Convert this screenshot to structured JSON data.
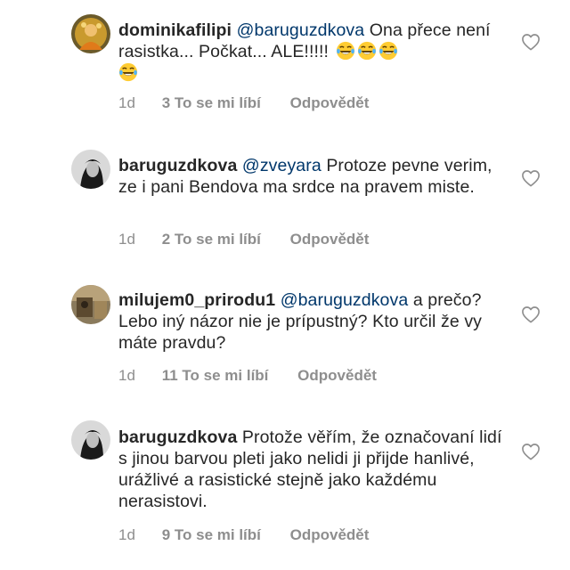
{
  "comments": [
    {
      "username": "dominikafilipi",
      "mention": "@baruguzdkova",
      "text": " Ona přece není rasistka... Počkat... ALE!!!!! ",
      "emoji": "laughing-tears-emoji",
      "emoji_count": 4,
      "time": "1d",
      "likes": "3 To se mi líbí",
      "reply": "Odpovědět"
    },
    {
      "username": "baruguzdkova",
      "mention": "@zveyara",
      "text": " Protoze pevne verim, ze i pani Bendova ma srdce na pravem miste.",
      "time": "1d",
      "likes": "2 To se mi líbí",
      "reply": "Odpovědět"
    },
    {
      "username": "milujem0_prirodu1",
      "mention": "@baruguzdkova",
      "text": " a prečo? Lebo iný názor nie je prípustný? Kto určil že vy máte pravdu?",
      "time": "1d",
      "likes": "11 To se mi líbí",
      "reply": "Odpovědět"
    },
    {
      "username": "baruguzdkova",
      "mention": "",
      "text": " Protože věřím, že označovaní lidí s jinou barvou pleti jako nelidi ji přijde hanlivé, urážlivé a rasistické stejně jako každému nerasistovi.",
      "time": "1d",
      "likes": "9 To se mi líbí",
      "reply": "Odpovědět"
    }
  ],
  "colors": {
    "text": "#262626",
    "mention": "#00376b",
    "meta": "#8e8e8e"
  },
  "icons": {
    "like": "heart-outline-icon"
  }
}
